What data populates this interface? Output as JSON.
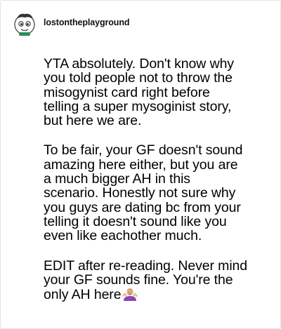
{
  "post": {
    "username": "lostontheplayground",
    "avatar_icon": "cartoon-character-avatar",
    "paragraphs": [
      "YTA absolutely. Don't know why\nyou told people not to throw the\nmisogynist card right before\ntelling a super mysoginist story,\nbut here we are.",
      "To be fair, your GF doesn't sound\namazing here either, but you are\na much bigger AH in this\nscenario. Honestly not sure why\nyou guys are dating bc from your\ntelling it doesn't sound like you\neven like eachother much.",
      "EDIT after re-reading. Never mind\nyour GF sounds fine. You're the\nonly AH here"
    ],
    "trailing_emoji": "person-shrugging-emoji"
  },
  "colors": {
    "border": "#e3e3e3",
    "text": "#000000",
    "emoji_shirt": "#8e44ad",
    "emoji_skin": "#e0b48a"
  }
}
